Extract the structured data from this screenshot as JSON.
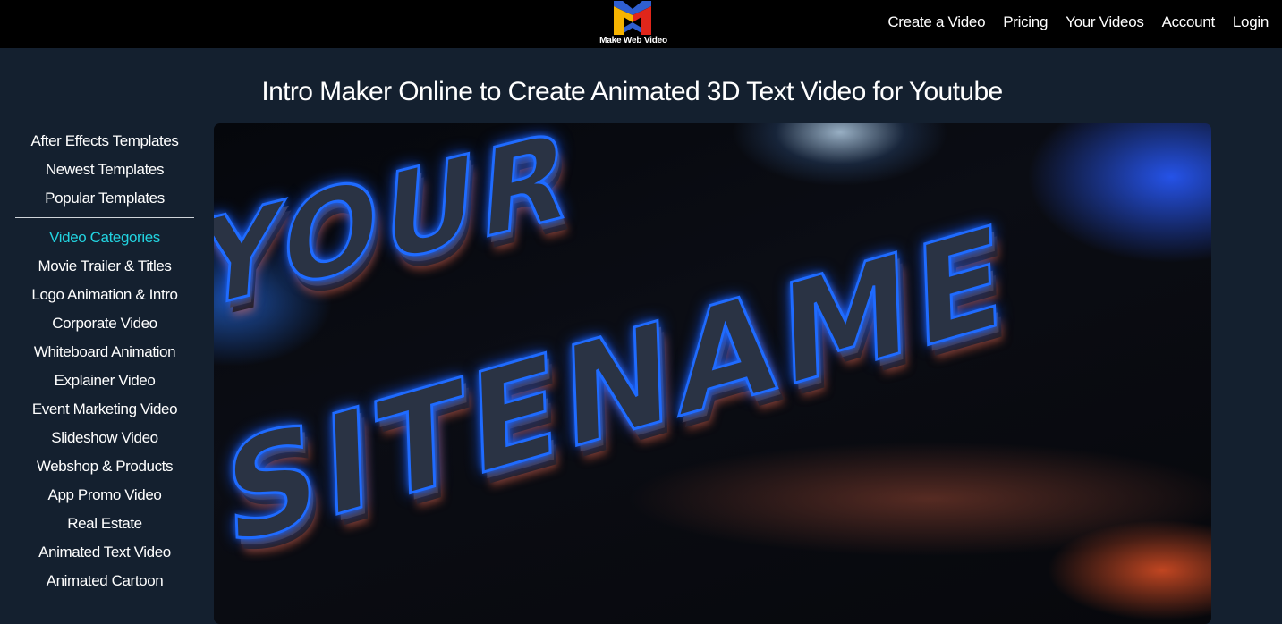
{
  "header": {
    "logo_text": "Make Web Video",
    "nav": [
      {
        "label": "Create a Video"
      },
      {
        "label": "Pricing"
      },
      {
        "label": "Your Videos"
      },
      {
        "label": "Account"
      },
      {
        "label": "Login"
      }
    ]
  },
  "page": {
    "title": "Intro Maker Online to Create Animated 3D Text Video for Youtube"
  },
  "sidebar": {
    "top_links": [
      {
        "label": "After Effects Templates"
      },
      {
        "label": "Newest Templates"
      },
      {
        "label": "Popular Templates"
      }
    ],
    "categories_heading": "Video Categories",
    "categories": [
      {
        "label": "Movie Trailer & Titles"
      },
      {
        "label": "Logo Animation & Intro"
      },
      {
        "label": "Corporate Video"
      },
      {
        "label": "Whiteboard Animation"
      },
      {
        "label": "Explainer Video"
      },
      {
        "label": "Event Marketing Video"
      },
      {
        "label": "Slideshow Video"
      },
      {
        "label": "Webshop & Products"
      },
      {
        "label": "App Promo Video"
      },
      {
        "label": "Real Estate"
      },
      {
        "label": "Animated Text Video"
      },
      {
        "label": "Animated Cartoon"
      }
    ]
  },
  "video": {
    "frame_text_line1": "YOUR",
    "frame_text_line2": "SITENAME"
  },
  "colors": {
    "header_bg": "#000000",
    "page_bg": "#14202f",
    "accent": "#22d3e0",
    "logo_blue": "#2f5fd0",
    "logo_yellow": "#f5b301",
    "logo_red": "#e0261b"
  }
}
